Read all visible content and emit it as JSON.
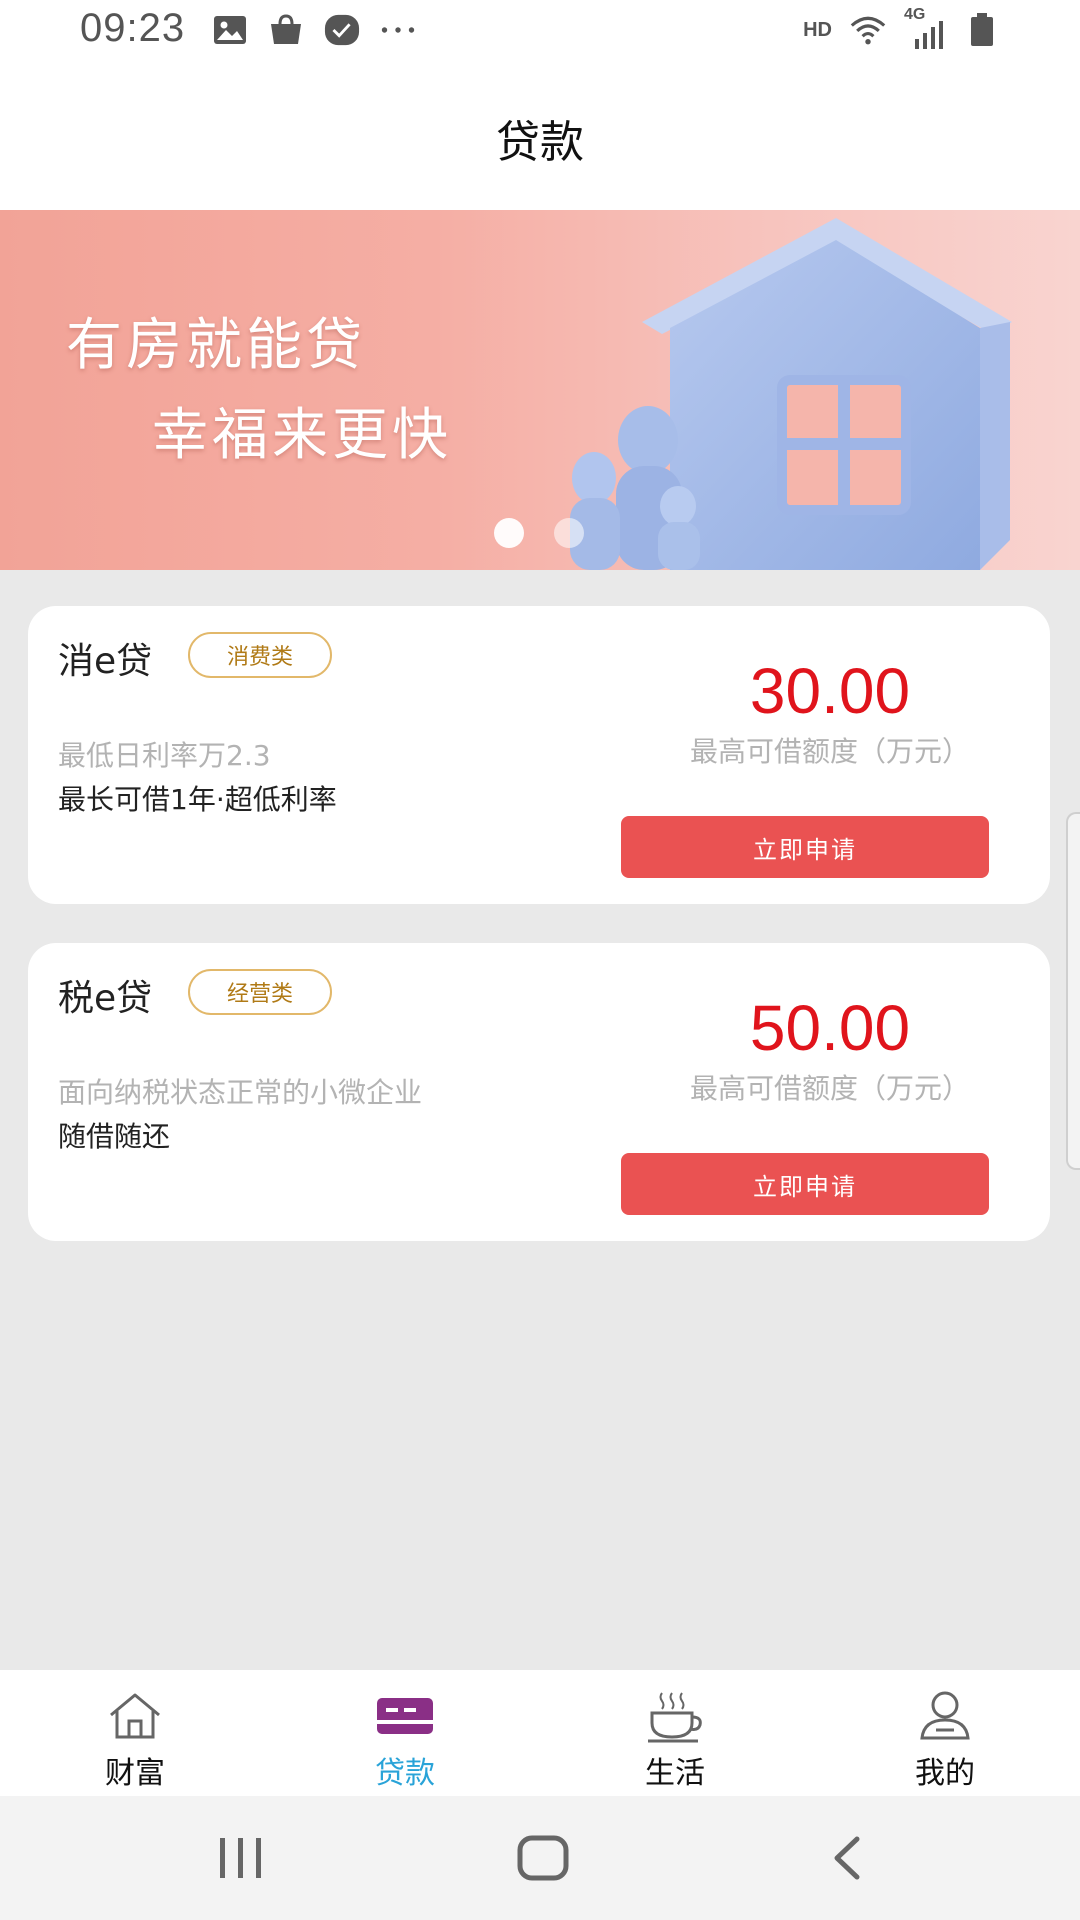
{
  "status_bar": {
    "time": "09:23",
    "hd_label": "HD",
    "network_label": "4G",
    "left_icons": [
      "image-icon",
      "shopping-bag-icon",
      "check-badge-icon",
      "more-dots-icon"
    ],
    "right_icons": [
      "wifi-icon",
      "signal-icon",
      "battery-icon"
    ]
  },
  "header": {
    "title": "贷款"
  },
  "banner": {
    "line1": "有房就能贷",
    "line2": "幸福来更快",
    "slide_count": 2,
    "active_slide": 1
  },
  "loans": [
    {
      "name": "消e贷",
      "tag": "消费类",
      "desc_secondary": "最低日利率万2.3",
      "desc_primary": "最长可借1年·超低利率",
      "amount": "30.00",
      "amount_label": "最高可借额度（万元）",
      "button": "立即申请"
    },
    {
      "name": "税e贷",
      "tag": "经营类",
      "desc_secondary": "面向纳税状态正常的小微企业",
      "desc_primary": "随借随还",
      "amount": "50.00",
      "amount_label": "最高可借额度（万元）",
      "button": "立即申请"
    }
  ],
  "tabbar": {
    "active_index": 1,
    "active_color": "#29a3d8",
    "items": [
      {
        "label": "财富",
        "icon": "home-icon"
      },
      {
        "label": "贷款",
        "icon": "card-icon"
      },
      {
        "label": "生活",
        "icon": "coffee-cup-icon"
      },
      {
        "label": "我的",
        "icon": "user-icon"
      }
    ]
  },
  "colors": {
    "amount": "#e0141c",
    "apply_button": "#ea5252",
    "tag_border": "#e2b86a",
    "banner": "#f2a397"
  }
}
